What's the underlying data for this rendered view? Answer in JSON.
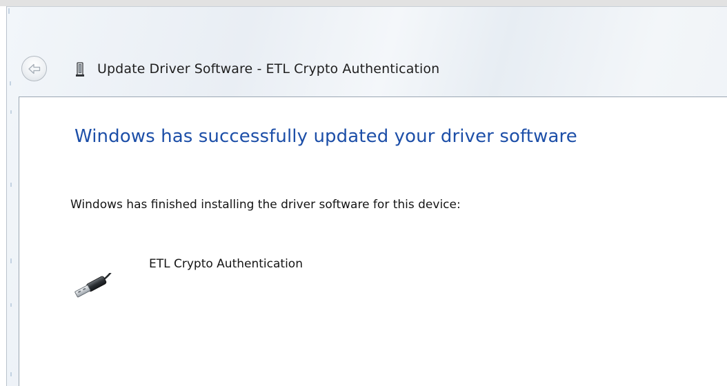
{
  "window": {
    "title": "Update Driver Software - ETL Crypto Authentication",
    "title_icon": "device-driver-icon",
    "back_icon": "back-arrow-icon"
  },
  "content": {
    "heading": "Windows has successfully updated your driver software",
    "message": "Windows has finished installing the driver software for this device:",
    "device": {
      "name": "ETL Crypto Authentication",
      "icon": "usb-device-icon"
    }
  },
  "colors": {
    "heading": "#1d4fa8",
    "body_text": "#141414",
    "title_text": "#1e1e1e",
    "glass_frame": "#eef2f6",
    "panel_border": "#9aa6b2"
  }
}
